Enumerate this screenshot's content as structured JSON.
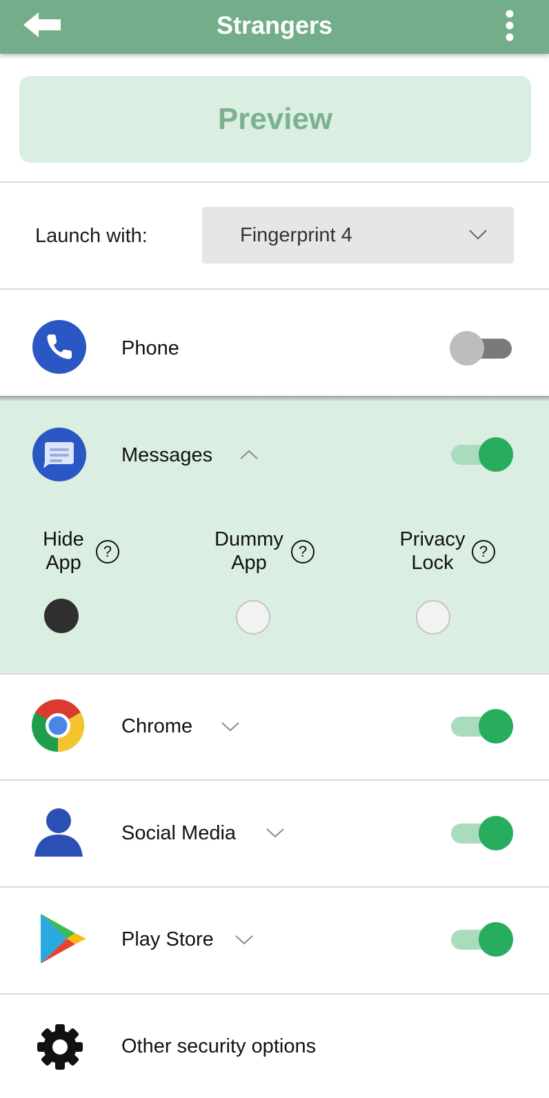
{
  "header": {
    "title": "Strangers",
    "back_icon": "back-arrow-icon",
    "menu_icon": "more-vert-icon"
  },
  "preview": {
    "label": "Preview"
  },
  "launch": {
    "label": "Launch with:",
    "selected": "Fingerprint 4"
  },
  "apps": [
    {
      "name": "Phone",
      "icon": "phone-icon",
      "enabled": false
    },
    {
      "name": "Messages",
      "icon": "messages-icon",
      "enabled": true,
      "expanded": true
    },
    {
      "name": "Chrome",
      "icon": "chrome-icon",
      "enabled": true,
      "expanded": false
    },
    {
      "name": "Social Media",
      "icon": "person-icon",
      "enabled": true,
      "expanded": false
    },
    {
      "name": "Play Store",
      "icon": "play-store-icon",
      "enabled": true,
      "expanded": false
    }
  ],
  "options": [
    {
      "line1": "Hide",
      "line2": "App",
      "help": "?",
      "selected": true
    },
    {
      "line1": "Dummy",
      "line2": "App",
      "help": "?",
      "selected": false
    },
    {
      "line1": "Privacy",
      "line2": "Lock",
      "help": "?",
      "selected": false
    }
  ],
  "other": {
    "label": "Other security options",
    "icon": "gear-icon"
  },
  "colors": {
    "header": "#74ad89",
    "accent": "#28ad5f",
    "expanded_bg": "#daeee2"
  }
}
